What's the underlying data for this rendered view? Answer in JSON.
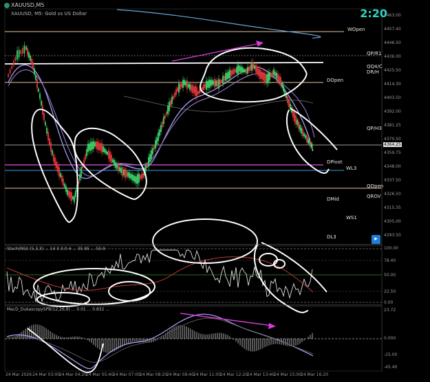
{
  "window": {
    "symbol_title": "XAUUSD,M5",
    "instrument_label": "XAUUSD, M5: Gold vs US Dollar",
    "clock": "2:20"
  },
  "price_axis": {
    "ticks": [
      "4463.00",
      "4457.40",
      "4446.50",
      "4436.00",
      "4425.50",
      "4414.30",
      "4403.50",
      "4392.00",
      "4381.25",
      "4370.50",
      "4359.75",
      "4348.00",
      "4337.50",
      "4326.50",
      "4315.35",
      "4305.00",
      "4293.50"
    ],
    "current_price": "4364.25"
  },
  "levels": [
    {
      "name": "WOpen",
      "color": "#e9c9a0"
    },
    {
      "name": "QP/R1",
      "color": "#e9c9a0"
    },
    {
      "name": "DOpen",
      "color": "#e9c9a0"
    },
    {
      "name": "QP/H3",
      "color": "#cfcfcf"
    },
    {
      "name": "DPivot",
      "color": "#c040c0"
    },
    {
      "name": "WL3",
      "color": "#3aa0e0"
    },
    {
      "name": "QOpen",
      "color": "#e9c9a0"
    },
    {
      "name": "DMid",
      "color": "#cfcfcf"
    },
    {
      "name": "QROV",
      "color": "#cfcfcf"
    },
    {
      "name": "WS1",
      "color": "#cfcfcf"
    },
    {
      "name": "DL3",
      "color": "#cfcfcf"
    }
  ],
  "top_right_labels": [
    "QQ4/C",
    "DR/H"
  ],
  "stoch_panel": {
    "title": "Stoch(RSI) (5,3,3) ... 14 3 3.0 4 ... 35.95 ... 55.9",
    "ticks": [
      "100.00",
      "78.40",
      "50.00",
      "22.50",
      "0.00"
    ]
  },
  "macd_panel": {
    "title": "MacD_DukascopySPB(12,26,9) ... 0.01 ... 0.832 ...",
    "ticks": [
      "23.72",
      "0.000",
      "-25.00",
      "-45.40"
    ]
  },
  "time_axis": [
    "24 Mar 2026",
    "24 Mar 03:00",
    "24 Mar 04:20",
    "24 Mar 05:40",
    "24 Mar 07:00",
    "24 Mar 08:20",
    "24 Mar 09:40",
    "24 Mar 11:00",
    "24 Mar 12:20",
    "24 Mar 13:40",
    "24 Mar 15:00",
    "24 Mar 16:20"
  ],
  "colors": {
    "bull": "#3ed66a",
    "bear": "#e5383b",
    "ma_fast": "#b0a8ff",
    "ma_slow": "#8c6fb8",
    "trend_arrow": "#d73bd7",
    "annotation": "#ffffff"
  }
}
